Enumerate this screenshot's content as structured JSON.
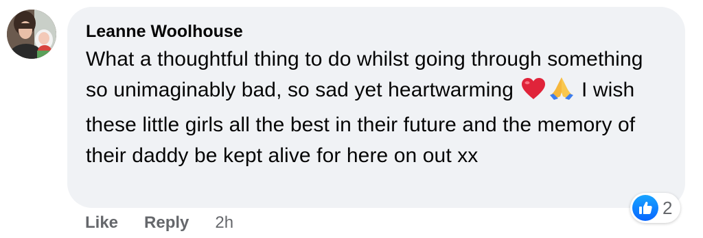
{
  "comment": {
    "author": "Leanne Woolhouse",
    "text_part1": "What a thoughtful thing to do whilst going through something so unimaginably bad, so sad yet heartwarming",
    "emoji_1": "red-heart",
    "emoji_2": "folded-hands",
    "text_part2": "I wish these little girls all the best in their future and the memory of their daddy be kept alive for here on out xx"
  },
  "reactions": {
    "icon": "like-thumbs-up-icon",
    "count": "2",
    "color": "#0866ff"
  },
  "actions": {
    "like_label": "Like",
    "reply_label": "Reply",
    "timestamp": "2h"
  },
  "colors": {
    "bubble_bg": "#f0f2f5",
    "text": "#050505",
    "secondary_text": "#65676b"
  }
}
